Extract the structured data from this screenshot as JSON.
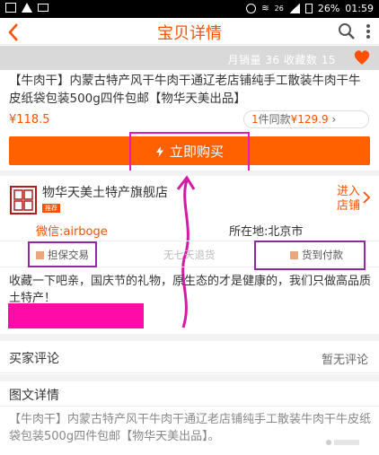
{
  "status_bar": {
    "battery": "26%",
    "time": "01:59",
    "network": "26"
  },
  "nav": {
    "title": "宝贝详情"
  },
  "stats": {
    "text": "月销量 36  收藏数 15"
  },
  "product": {
    "title": "【牛肉干】内蒙古特产风干牛肉干通辽老店铺纯手工散装牛肉干牛皮纸袋包装500g四件包邮【物华天美出品】",
    "price": "¥118.5",
    "same_count": "1",
    "same_text": "件同款",
    "same_price": "¥129.9",
    "same_chevron": "›"
  },
  "buy_button": {
    "label": "立即购买"
  },
  "shop": {
    "name": "物华天美土特产旗舰店",
    "tag": "推荐",
    "enter_label": "进入店铺",
    "wechat": "微信:airboge",
    "location": "所在地:北京市"
  },
  "services": [
    "担保交易",
    "无七天退货",
    "货到付款"
  ],
  "description": "收藏一下吧亲，国庆节的礼物，原生态的才是健康的，我们只做高品质土特产！",
  "reviews": {
    "label": "买家评论",
    "status": "暂无评论"
  },
  "details": {
    "label": "图文详情",
    "text": "【牛肉干】内蒙古特产风干牛肉干通辽老店铺纯手工散装牛肉干牛皮纸袋包装500g四件包邮【物华天美出品】。"
  },
  "colors": {
    "accent": "#ff5000",
    "highlight": "#e31cb5",
    "mask": "#ff0ca8"
  }
}
